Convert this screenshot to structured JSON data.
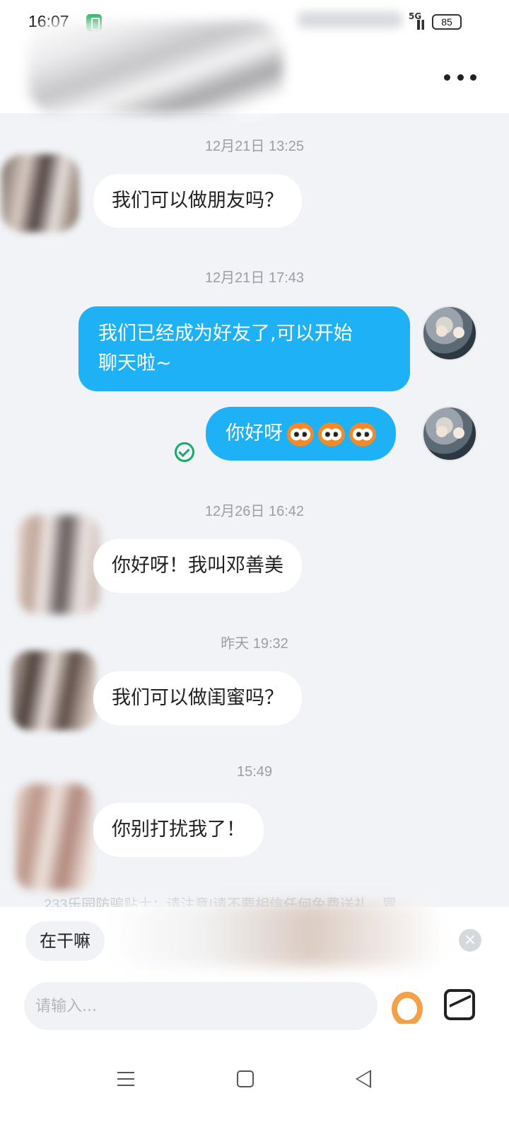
{
  "status_bar": {
    "time": "16:07",
    "network": "5G",
    "battery": "85"
  },
  "header": {
    "more_icon": "more-dots-icon"
  },
  "messages": [
    {
      "time": "12月21日 13:25",
      "side": "left",
      "text": "我们可以做朋友吗？"
    },
    {
      "time": "12月21日 17:43",
      "side": "right",
      "text_line1": "我们已经成为好友了,可以开始",
      "text_line2": "聊天啦~"
    },
    {
      "side": "right",
      "text": "你好呀",
      "emoji": "monkey-face-emoji",
      "emoji_count": 3,
      "status_icon": "sent-check-icon"
    },
    {
      "time": "12月26日 16:42",
      "side": "left",
      "text": "你好呀！我叫邓善美"
    },
    {
      "time": "昨天 19:32",
      "side": "left",
      "text": "我们可以做闺蜜吗？"
    },
    {
      "time": "15:49",
      "side": "left",
      "text": "你别打扰我了！"
    }
  ],
  "tip": {
    "text": "233乐园防骗贴士：请注意!请不要相信任何免费送礼、冒"
  },
  "quick_reply": {
    "text": "在干嘛"
  },
  "composer": {
    "placeholder": "请输入...",
    "sticker_icon": "sticker-icon",
    "image_icon": "image-icon"
  },
  "nav": {
    "menu_icon": "menu-icon",
    "home_icon": "home-icon",
    "back_icon": "back-icon"
  },
  "colors": {
    "accent_blue": "#1fb1f5",
    "sent_green": "#1aa86b",
    "background": "#f1f3f7"
  }
}
